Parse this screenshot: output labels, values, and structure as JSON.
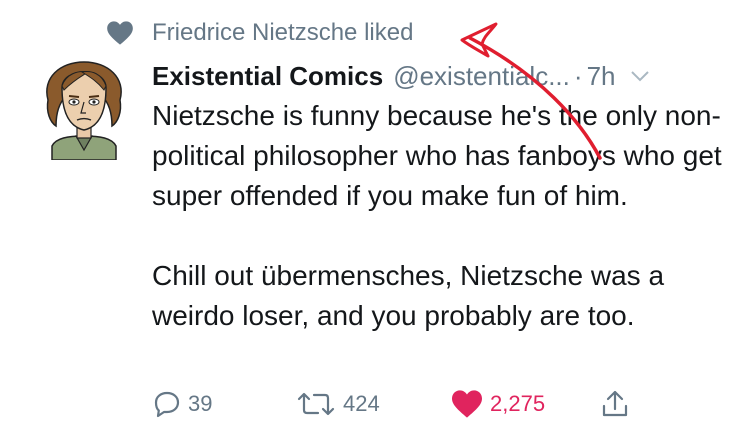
{
  "liked_by": {
    "text": "Friedrice Nietzsche liked",
    "icon": "heart-icon"
  },
  "tweet": {
    "author_name": "Existential Comics",
    "handle": "@existentialc...",
    "separator": "·",
    "time": "7h",
    "paragraphs": [
      "Nietzsche is funny because he's the only non-political philosopher who has fanboys who get super offended if you make fun of him.",
      "Chill out übermensches, Nietzsche was a weirdo loser, and you probably are too."
    ]
  },
  "actions": {
    "reply_count": "39",
    "retweet_count": "424",
    "like_count": "2,275"
  },
  "colors": {
    "muted": "#657786",
    "text": "#14171a",
    "like": "#e0245e",
    "annotation": "#e01e2f"
  }
}
